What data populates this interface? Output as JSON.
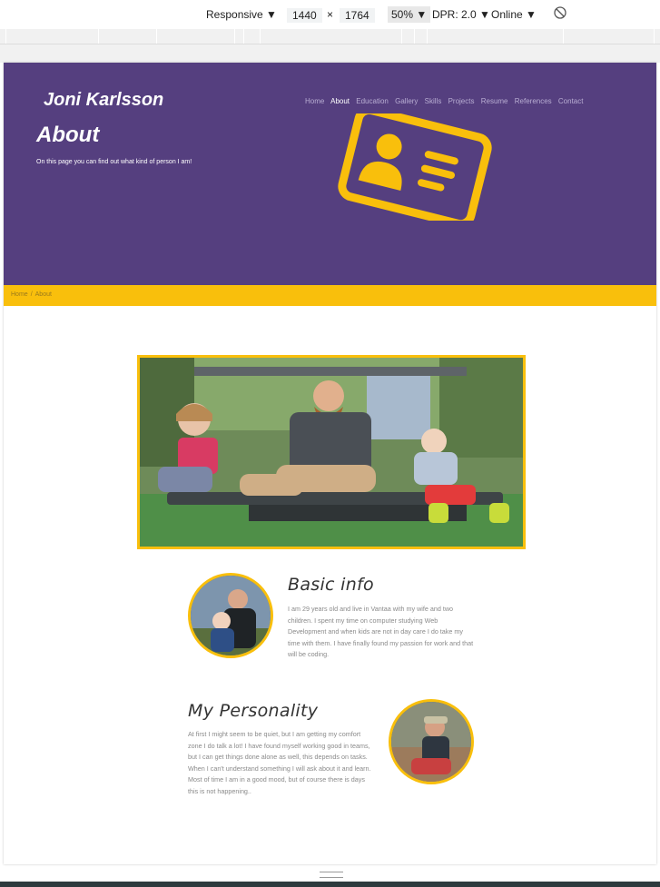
{
  "devtools": {
    "device": "Responsive",
    "width": "1440",
    "times": "×",
    "height": "1764",
    "zoom": "50%",
    "dpr": "DPR: 2.0",
    "network": "Online"
  },
  "site": {
    "brand": "Joni Karlsson",
    "nav": [
      "Home",
      "About",
      "Education",
      "Gallery",
      "Skills",
      "Projects",
      "Resume",
      "References",
      "Contact"
    ],
    "active_nav": "About",
    "hero_title": "About",
    "hero_subtitle": "On this page you can find out what kind of person I am!",
    "breadcrumb": {
      "home": "Home",
      "sep": "/",
      "current": "About"
    },
    "basic_title": "Basic info",
    "basic_text": "I am 29 years old and live in Vantaa with my wife and two children. I spent my time on computer studying Web Development and when kids are not in day care I do take my time with them. I have finally found my passion for work and that will be coding.",
    "personality_title": "My Personality",
    "personality_text": "At first I might seem to be quiet, but I am getting my comfort zone I do talk a lot! I have found myself working good in teams, but I can get things done alone as well, this depends on tasks. When I can't understand something I will ask about it and learn. Most of time I am in a good mood, but of course there is days this is not happening..",
    "colors": {
      "purple": "#553f7f",
      "yellow": "#f9bf0c"
    }
  }
}
